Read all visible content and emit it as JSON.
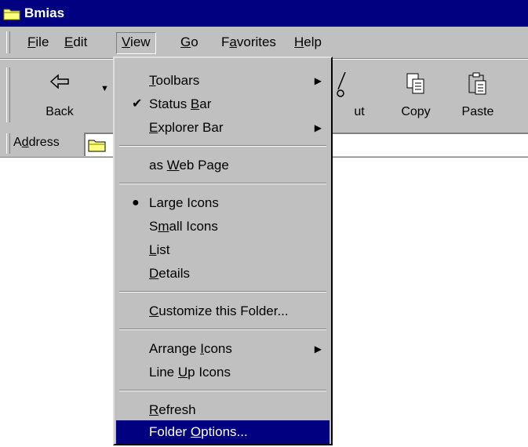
{
  "window": {
    "title": "Bmias"
  },
  "menubar": [
    {
      "label": "File",
      "u": "F",
      "rest": "ile"
    },
    {
      "label": "Edit",
      "u": "E",
      "rest": "dit"
    },
    {
      "label": "View",
      "u": "V",
      "rest": "iew"
    },
    {
      "label": "Go",
      "u": "G",
      "rest": "o"
    },
    {
      "label": "Favorites",
      "pre": "F",
      "u": "a",
      "rest": "vorites"
    },
    {
      "label": "Help",
      "u": "H",
      "rest": "elp"
    }
  ],
  "toolbar": {
    "back": "Back",
    "cut_partial": "ut",
    "copy": "Copy",
    "paste": "Paste"
  },
  "address": {
    "pre": "A",
    "u": "d",
    "rest": "dress"
  },
  "view_menu": {
    "toolbars": {
      "u": "T",
      "rest": "oolbars"
    },
    "status_bar": {
      "pre": "Status ",
      "u": "B",
      "rest": "ar"
    },
    "explorer_bar": {
      "u": "E",
      "rest": "xplorer Bar"
    },
    "web_page": {
      "pre": "as ",
      "u": "W",
      "rest": "eb Page"
    },
    "large_icons": {
      "pre": "Lar",
      "u": "g",
      "rest": "e Icons"
    },
    "small_icons": {
      "pre": "S",
      "u": "m",
      "rest": "all Icons"
    },
    "list": {
      "u": "L",
      "rest": "ist"
    },
    "details": {
      "u": "D",
      "rest": "etails"
    },
    "customize": {
      "u": "C",
      "rest": "ustomize this Folder..."
    },
    "arrange": {
      "pre": "Arrange ",
      "u": "I",
      "rest": "cons"
    },
    "line_up": {
      "pre": "Line ",
      "u": "U",
      "rest": "p Icons"
    },
    "refresh": {
      "u": "R",
      "rest": "efresh"
    },
    "folder_options": {
      "pre": "Folder ",
      "u": "O",
      "rest": "ptions..."
    }
  }
}
